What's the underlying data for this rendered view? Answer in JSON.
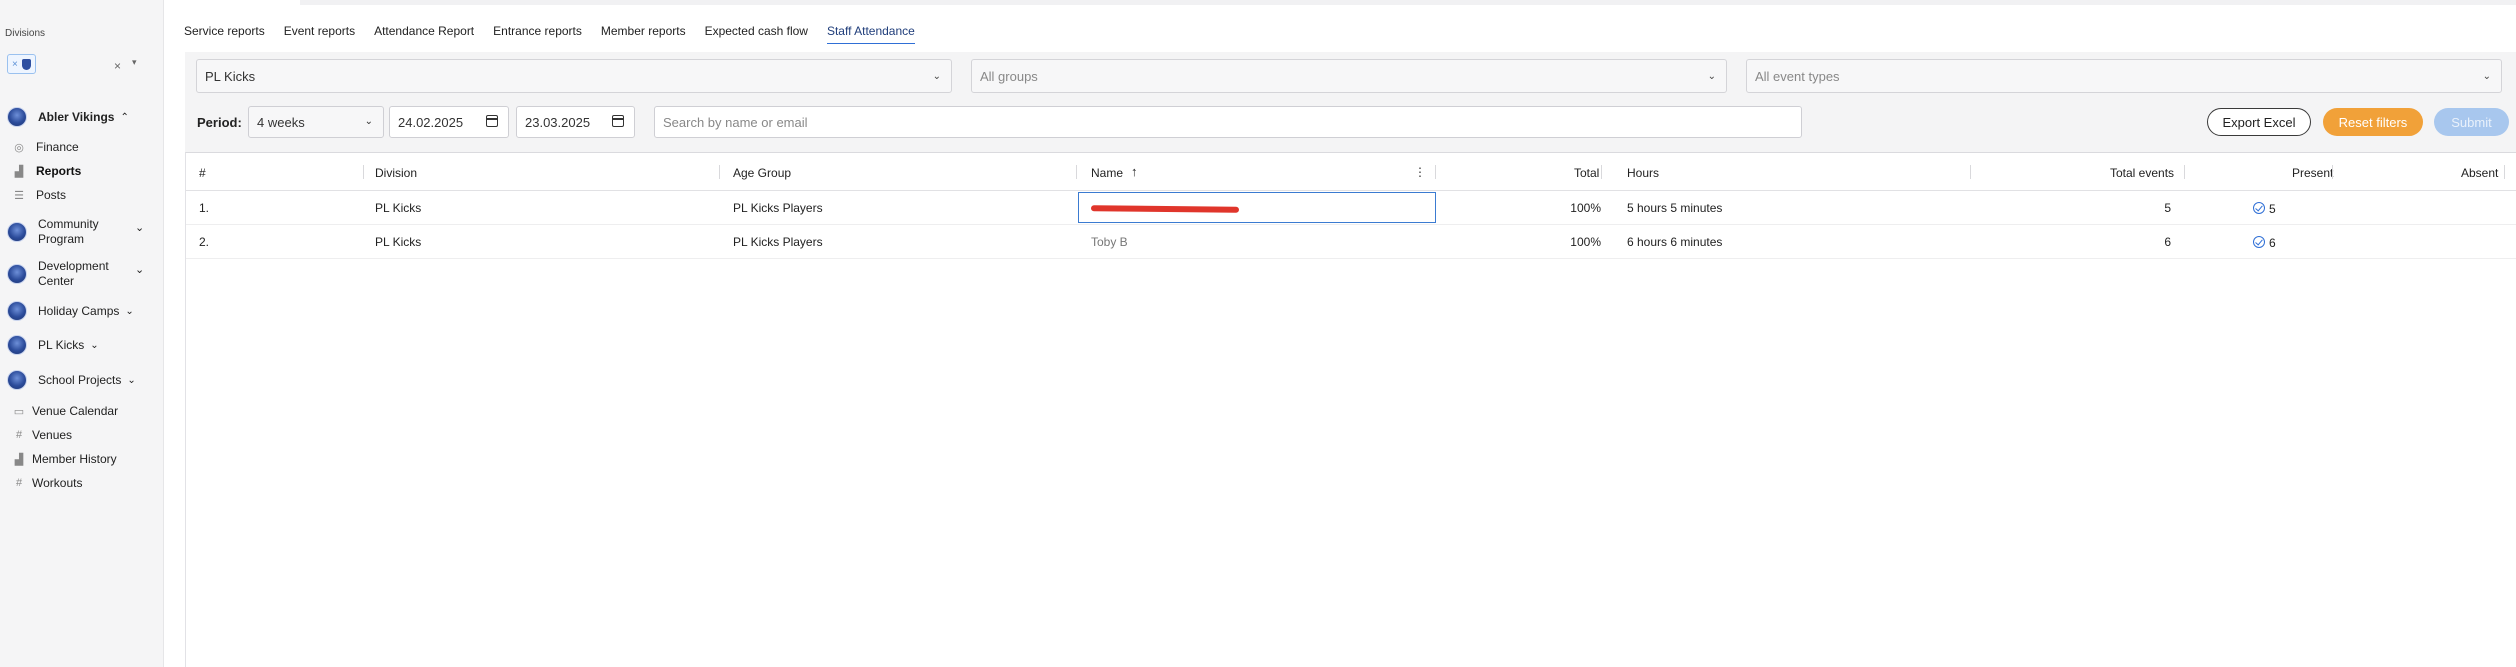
{
  "sidebar": {
    "divisions_label": "Divisions",
    "divisions_chip_close": "×",
    "divisions_clear": "×",
    "orgs": [
      {
        "label": "Abler Vikings"
      },
      {
        "label": "Community Program"
      },
      {
        "label": "Development Center"
      },
      {
        "label": "Holiday Camps"
      },
      {
        "label": "PL Kicks"
      },
      {
        "label": "School Projects"
      }
    ],
    "items": [
      {
        "label": "Finance"
      },
      {
        "label": "Reports"
      },
      {
        "label": "Posts"
      },
      {
        "label": "Venue Calendar"
      },
      {
        "label": "Venues"
      },
      {
        "label": "Member History"
      },
      {
        "label": "Workouts"
      }
    ]
  },
  "tabs": [
    "Service reports",
    "Event reports",
    "Attendance Report",
    "Entrance reports",
    "Member reports",
    "Expected cash flow",
    "Staff Attendance"
  ],
  "active_tab": "Staff Attendance",
  "filters": {
    "division_value": "PL Kicks",
    "groups_placeholder": "All groups",
    "event_types_placeholder": "All event types",
    "period_label": "Period:",
    "period_value": "4 weeks",
    "date_from": "24.02.2025",
    "date_to": "23.03.2025",
    "search_placeholder": "Search by name or email"
  },
  "buttons": {
    "export": "Export Excel",
    "reset": "Reset filters",
    "submit": "Submit"
  },
  "table": {
    "headers": {
      "num": "#",
      "division": "Division",
      "age_group": "Age Group",
      "name": "Name",
      "total": "Total",
      "hours": "Hours",
      "total_events": "Total events",
      "present": "Present",
      "absent": "Absent"
    },
    "rows": [
      {
        "num": "1.",
        "division": "PL Kicks",
        "age_group": "PL Kicks Players",
        "name": "",
        "total": "100%",
        "hours": "5 hours 5 minutes",
        "total_events": "5",
        "present": "5"
      },
      {
        "num": "2.",
        "division": "PL Kicks",
        "age_group": "PL Kicks Players",
        "name": "Toby B",
        "total": "100%",
        "hours": "6 hours 6 minutes",
        "total_events": "6",
        "present": "6"
      }
    ]
  },
  "colors": {
    "accent": "#2f6fd6",
    "reset_button": "#f1a139",
    "submit_button": "#a8c7ee",
    "redaction": "#e0352b"
  }
}
